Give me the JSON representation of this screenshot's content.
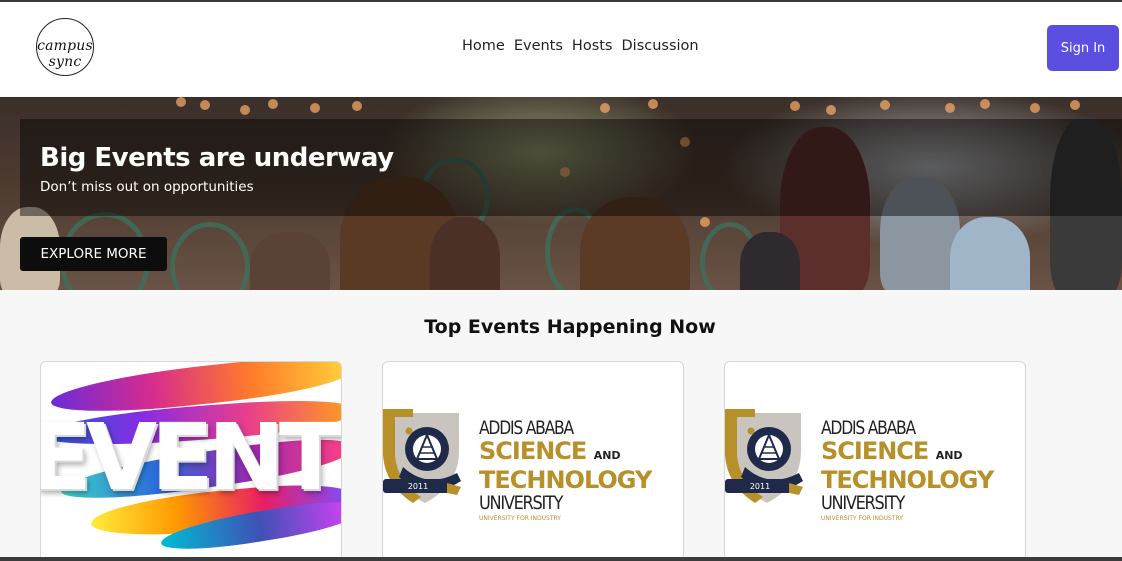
{
  "header": {
    "logo_text": "campus sync",
    "nav": [
      "Home",
      "Events",
      "Hosts",
      "Discussion"
    ],
    "signin_label": "Sign In"
  },
  "hero": {
    "title": "Big Events are underway",
    "subtitle": "Don’t miss out on opportunities",
    "cta_label": "EXPLORE MORE"
  },
  "section": {
    "title": "Top Events Happening Now"
  },
  "cards": [
    {
      "image_text": "EVENTS"
    },
    {
      "line1": "ADDIS ABABA",
      "line2": "SCIENCE",
      "and": "AND",
      "line3": "TECHNOLOGY",
      "line4": "UNIVERSITY",
      "line5": "UNIVERSITY FOR INDUSTRY",
      "year": "2011"
    },
    {
      "line1": "ADDIS ABABA",
      "line2": "SCIENCE",
      "and": "AND",
      "line3": "TECHNOLOGY",
      "line4": "UNIVERSITY",
      "line5": "UNIVERSITY FOR INDUSTRY",
      "year": "2011"
    }
  ],
  "colors": {
    "accent": "#5a4fe0",
    "gold": "#b8902a",
    "navy": "#1f2a4a"
  }
}
